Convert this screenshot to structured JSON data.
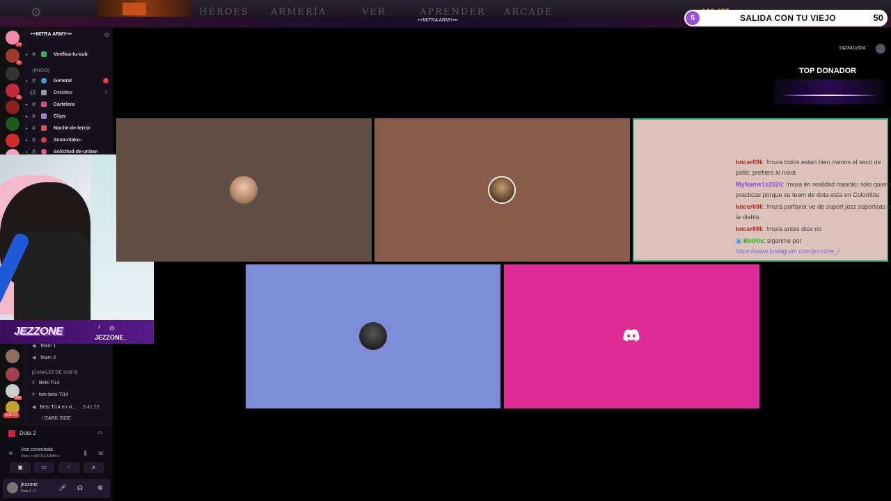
{
  "topbar": {
    "nav": [
      "HÉROES",
      "ARMERÍA",
      "VER",
      "APRENDER",
      "ARCADE"
    ],
    "gold": "128 435",
    "channel_title": "•••MITRA ARMY•••"
  },
  "now_playing": {
    "left_number": "5",
    "title": "SALIDA CON TU VIEJO",
    "right_number": "50"
  },
  "discord": {
    "guild_name": "•••MITRA ARMY•••",
    "channels_top": [
      {
        "label": "Verifica-tu-sub",
        "color": "#35b556",
        "badge": ""
      },
      {
        "label": "General",
        "color": "#3aa0e0",
        "badge": "1"
      },
      {
        "label": "Debates",
        "color": "#999",
        "badge": "1"
      },
      {
        "label": "Cartelera",
        "color": "#d85090",
        "badge": ""
      },
      {
        "label": "Clips",
        "color": "#a080d0",
        "badge": ""
      },
      {
        "label": "Noche-de-terror",
        "color": "#d05060",
        "badge": ""
      },
      {
        "label": "Zona-otaku-",
        "color": "#d04040",
        "badge": ""
      },
      {
        "label": "Solicitud-de-unban",
        "color": "#e06080",
        "badge": ""
      }
    ],
    "category_inicio": "[INICIO]",
    "voice_lower": [
      "Team 1",
      "Team 2"
    ],
    "category_subs": "[CANALES DE SUB'S]",
    "sub_channels": [
      "Bets-Ti14",
      "two-bets-Ti14",
      "Bets Ti14 en vi..."
    ],
    "sub_time": "3:41:22",
    "dark_side": "! DARK SIDE",
    "nuevo_badge": "NUEVO",
    "activity": "Dota 2",
    "voice_status": "Voz conectada",
    "voice_location": "Dota / •••MITRA ARMY•••",
    "username": "jezzone",
    "user_status": "Dota 2 +1"
  },
  "brand": {
    "logo": "JEZZONE",
    "handle": "JEZZONE_"
  },
  "overlay": {
    "viewers": "1423411624",
    "top_donor_title": "TOP DONADOR"
  },
  "chat": [
    {
      "user": "kncer69k",
      "user_class": "u1",
      "text": ": !mura todos estan bien menos el seco de pollo, prefiero al nova"
    },
    {
      "user": "MyName1s2026",
      "user_class": "u2",
      "text": ": !mura en realidad masoku solo quiero practicas porque su team de dota esta en Colombia"
    },
    {
      "user": "kncer69k",
      "user_class": "u1",
      "text": ": !mura porfavor ve de suport jezz suporteas a la diabla"
    },
    {
      "user": "kncer69k",
      "user_class": "u1",
      "text": ": !mura antes dice no"
    },
    {
      "user": "BotRix",
      "user_class": "u3",
      "text": ": siganme por",
      "link": "https://www.instagram.com/jezzone_/"
    }
  ],
  "colors": {
    "accent_purple": "#9b4fd6",
    "discord_blurple": "#7d8dd8",
    "discord_pink": "#de2d97",
    "speaking_green": "#43b581"
  }
}
